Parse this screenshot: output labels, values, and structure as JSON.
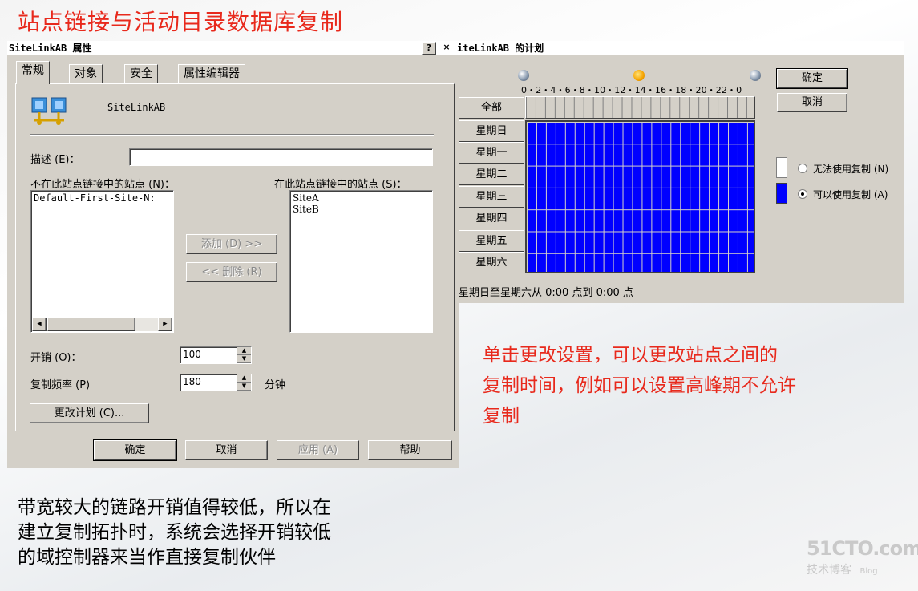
{
  "slide_title": "站点链接与活动目录数据库复制",
  "props_dialog": {
    "title": "SiteLinkAB 属性",
    "help_btn": "?",
    "close_btn": "×",
    "tabs": [
      "常规",
      "对象",
      "安全",
      "属性编辑器"
    ],
    "object_name": "SiteLinkAB",
    "desc_label": "描述 (E)：",
    "desc_value": "",
    "not_in_label": "不在此站点链接中的站点 (N)：",
    "in_label": "在此站点链接中的站点 (S)：",
    "not_in_sites": [
      "Default-First-Site-N:"
    ],
    "in_sites": [
      "SiteA",
      "SiteB"
    ],
    "add_btn": "添加 (D) >>",
    "remove_btn": "<< 删除 (R)",
    "cost_label": "开销 (O)：",
    "cost_value": "100",
    "freq_label": "复制频率 (P)",
    "freq_value": "180",
    "freq_unit": "分钟",
    "change_btn": "更改计划 (C)...",
    "ok_btn": "确定",
    "cancel_btn": "取消",
    "apply_btn": "应用 (A)",
    "help_button": "帮助"
  },
  "schedule_dialog": {
    "title": "iteLinkAB 的计划",
    "hour_ticks": "0・2・4・6・8・10・12・14・16・18・20・22・0",
    "all_btn": "全部",
    "days": [
      "星期日",
      "星期一",
      "星期二",
      "星期三",
      "星期四",
      "星期五",
      "星期六"
    ],
    "status_text": "星期日至星期六从 0:00 点到 0:00 点",
    "ok_btn": "确定",
    "cancel_btn": "取消",
    "legend_unavailable": "无法使用复制 (N)",
    "legend_available": "可以使用复制 (A)",
    "selected": "可以使用复制 (A)",
    "grid_color": "#0000ff"
  },
  "note_red": [
    "单击更改设置，可以更改站点之间的",
    "复制时间，例如可以设置高峰期不允许",
    "复制"
  ],
  "note_black": [
    "带宽较大的链路开销值得较低，所以在",
    "建立复制拓扑时，系统会选择开销较低",
    "的域控制器来当作直接复制伙伴"
  ],
  "watermark": {
    "brand": "51CTO.com",
    "sub": "技术博客",
    "blog": "Blog"
  }
}
